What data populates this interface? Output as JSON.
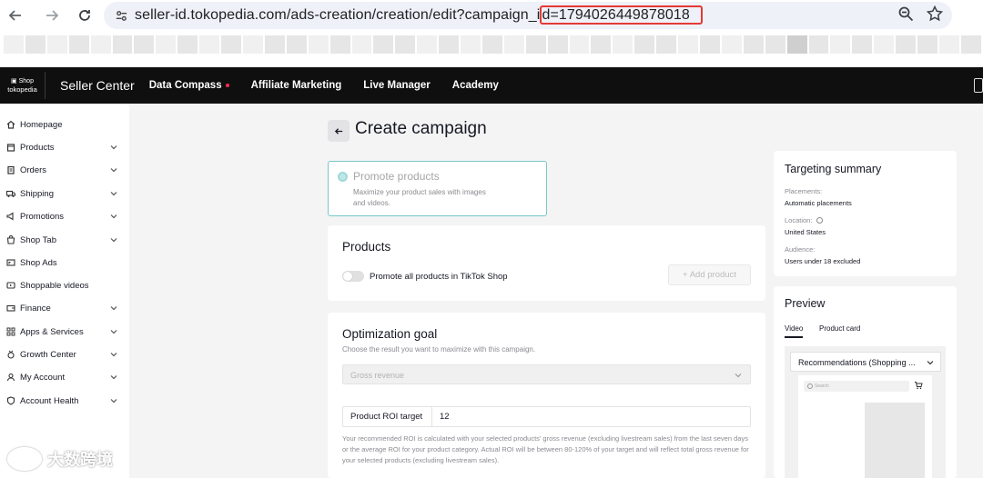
{
  "browser": {
    "url_prefix": "seller-id.tokopedia.com/ads-creation/creation/edit?campaign_i",
    "url_id_part": "d=1794026449878018"
  },
  "topbar": {
    "logo_top": "Shop",
    "logo_bottom": "tokopedia",
    "brand": "Seller Center",
    "nav": [
      "Data Compass",
      "Affiliate Marketing",
      "Live Manager",
      "Academy"
    ]
  },
  "sidebar": {
    "items": [
      {
        "label": "Homepage",
        "icon": "home-icon",
        "has_chevron": false
      },
      {
        "label": "Products",
        "icon": "box-icon",
        "has_chevron": true
      },
      {
        "label": "Orders",
        "icon": "clipboard-icon",
        "has_chevron": true
      },
      {
        "label": "Shipping",
        "icon": "truck-icon",
        "has_chevron": true
      },
      {
        "label": "Promotions",
        "icon": "megaphone-icon",
        "has_chevron": true
      },
      {
        "label": "Shop Tab",
        "icon": "shop-bag-icon",
        "has_chevron": true
      },
      {
        "label": "Shop Ads",
        "icon": "ads-icon",
        "has_chevron": false
      },
      {
        "label": "Shoppable videos",
        "icon": "video-icon",
        "has_chevron": false
      },
      {
        "label": "Finance",
        "icon": "wallet-icon",
        "has_chevron": true
      },
      {
        "label": "Apps & Services",
        "icon": "apps-icon",
        "has_chevron": true
      },
      {
        "label": "Growth Center",
        "icon": "medal-icon",
        "has_chevron": true
      },
      {
        "label": "My Account",
        "icon": "user-icon",
        "has_chevron": true
      },
      {
        "label": "Account Health",
        "icon": "shield-icon",
        "has_chevron": true
      }
    ]
  },
  "page": {
    "title": "Create campaign"
  },
  "promote": {
    "title": "Promote products",
    "desc": "Maximize your product sales with images and videos."
  },
  "products": {
    "title": "Products",
    "toggle_label": "Promote all products in TikTok Shop",
    "add_button": "+ Add product"
  },
  "optimization": {
    "title": "Optimization goal",
    "subtitle": "Choose the result you want to maximize with this campaign.",
    "select_value": "Gross revenue",
    "roi_label": "Product ROI target",
    "roi_value": "12",
    "roi_note": "Your recommended ROI is calculated with your selected products' gross revenue (excluding livestream sales) from the last seven days or the average ROI for your product category. Actual ROI will be between 80-120% of your target and will reflect total gross revenue for your selected products (excluding livestream sales)."
  },
  "targeting": {
    "title": "Targeting summary",
    "placements_label": "Placements:",
    "placements_value": "Automatic placements",
    "location_label": "Location:",
    "location_value": "United States",
    "audience_label": "Audience:",
    "audience_value": "Users under 18 excluded"
  },
  "preview": {
    "title": "Preview",
    "tabs": [
      "Video",
      "Product card"
    ],
    "select_value": "Recommendations (Shopping ...",
    "search_placeholder": "Search"
  },
  "watermark": {
    "text": "大数跨境"
  }
}
